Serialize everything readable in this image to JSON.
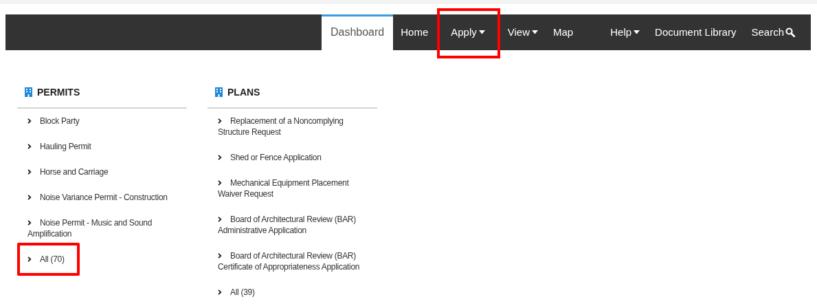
{
  "nav": [
    {
      "label": "Dashboard",
      "selected": true,
      "dropdown": false,
      "kind": "text",
      "highlighted": false
    },
    {
      "label": "Home",
      "selected": false,
      "dropdown": false,
      "kind": "text",
      "highlighted": false
    },
    {
      "label": "Apply",
      "selected": false,
      "dropdown": true,
      "kind": "text",
      "highlighted": true
    },
    {
      "label": "View",
      "selected": false,
      "dropdown": true,
      "kind": "text",
      "highlighted": false
    },
    {
      "label": "Map",
      "selected": false,
      "dropdown": false,
      "kind": "text",
      "highlighted": false
    },
    {
      "label": "Help",
      "selected": false,
      "dropdown": true,
      "kind": "text",
      "highlighted": false
    },
    {
      "label": "Document Library",
      "selected": false,
      "dropdown": false,
      "kind": "text",
      "highlighted": false
    },
    {
      "label": "Search",
      "selected": false,
      "dropdown": false,
      "kind": "search",
      "highlighted": false
    }
  ],
  "sections": [
    {
      "title": "PERMITS",
      "items": [
        {
          "label": "Block Party",
          "highlighted": false
        },
        {
          "label": "Hauling Permit",
          "highlighted": false
        },
        {
          "label": "Horse and Carriage",
          "highlighted": false
        },
        {
          "label": "Noise Variance Permit - Construction",
          "highlighted": false
        },
        {
          "label": "Noise Permit - Music and Sound Amplification",
          "highlighted": false
        },
        {
          "label": "All (70)",
          "highlighted": true
        }
      ]
    },
    {
      "title": "PLANS",
      "items": [
        {
          "label": "Replacement of a Noncomplying Structure Request",
          "highlighted": false
        },
        {
          "label": "Shed or Fence Application",
          "highlighted": false
        },
        {
          "label": "Mechanical Equipment Placement Waiver Request",
          "highlighted": false
        },
        {
          "label": "Board of Architectural Review (BAR) Administrative Application",
          "highlighted": false
        },
        {
          "label": "Board of Architectural Review (BAR) Certificate of Appropriateness Application",
          "highlighted": false
        },
        {
          "label": "All (39)",
          "highlighted": false
        }
      ]
    }
  ]
}
